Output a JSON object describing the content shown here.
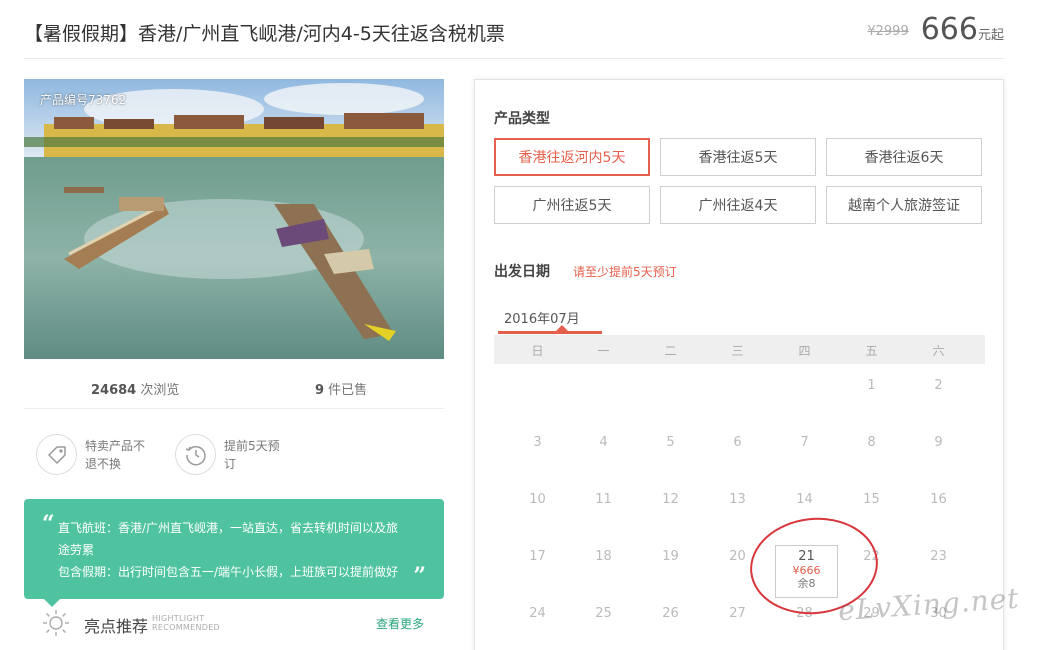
{
  "header": {
    "title": "【暑假假期】香港/广州直飞岘港/河内4-5天往返含税机票",
    "old_price": "¥2999",
    "price": "666",
    "price_unit": "元起"
  },
  "photo": {
    "product_code": "产品编号73762"
  },
  "stats": {
    "views_num": "24684",
    "views_label": " 次浏览",
    "sold_num": "9",
    "sold_label": " 件已售"
  },
  "features": [
    {
      "icon": "tag-icon",
      "text": "特卖产品不退不换"
    },
    {
      "icon": "clock-history-icon",
      "text": "提前5天预订"
    }
  ],
  "quote": {
    "line1": "直飞航班：香港/广州直飞岘港，一站直达，省去转机时间以及旅途劳累",
    "line2": "包含假期：出行时间包含五一/端午小长假，上班族可以提前做好"
  },
  "highlight": {
    "title": "亮点推荐",
    "en_line1": "HIGHTLIGHT",
    "en_line2": "RECOMMENDED",
    "more": "查看更多"
  },
  "product_type": {
    "label": "产品类型",
    "options": [
      "香港往返河内5天",
      "香港往返5天",
      "香港往返6天",
      "广州往返5天",
      "广州往返4天",
      "越南个人旅游签证"
    ],
    "selected": "香港往返河内5天"
  },
  "departure": {
    "label": "出发日期",
    "note": "请至少提前5天预订",
    "month": "2016年07月",
    "weekdays": [
      "日",
      "一",
      "二",
      "三",
      "四",
      "五",
      "六"
    ],
    "weeks": [
      [
        "",
        "",
        "",
        "",
        "",
        "1",
        "2"
      ],
      [
        "3",
        "4",
        "5",
        "6",
        "7",
        "8",
        "9"
      ],
      [
        "10",
        "11",
        "12",
        "13",
        "14",
        "15",
        "16"
      ],
      [
        "17",
        "18",
        "19",
        "20",
        "21",
        "22",
        "23"
      ],
      [
        "24",
        "25",
        "26",
        "27",
        "28",
        "29",
        "30"
      ]
    ],
    "available": {
      "day": "21",
      "price": "¥666",
      "remaining": "余8"
    }
  },
  "watermark": "eLvXing.net",
  "colors": {
    "accent": "#e5604c",
    "green": "#4fc3a0",
    "circle": "#d8363c"
  }
}
